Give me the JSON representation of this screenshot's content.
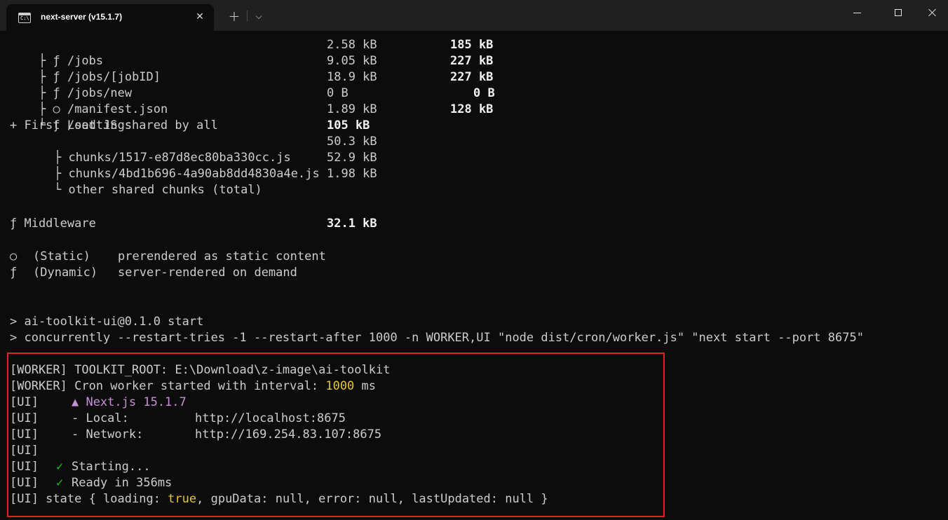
{
  "window": {
    "tab_title": "next-server (v15.1.7)",
    "tab_icon": "terminal-icon",
    "tab_icon_glyph": "C:\\",
    "close_tab_glyph": "✕",
    "new_tab_glyph": "+",
    "dropdown_glyph": "⌵"
  },
  "routes": [
    {
      "tree": "├",
      "type": "ƒ",
      "path": "/jobs",
      "size": "2.58 kB",
      "first_load": "185 kB"
    },
    {
      "tree": "├",
      "type": "ƒ",
      "path": "/jobs/[jobID]",
      "size": "9.05 kB",
      "first_load": "227 kB"
    },
    {
      "tree": "├",
      "type": "ƒ",
      "path": "/jobs/new",
      "size": "18.9 kB",
      "first_load": "227 kB"
    },
    {
      "tree": "├",
      "type": "○",
      "path": "/manifest.json",
      "size": "0 B",
      "first_load": "0 B"
    },
    {
      "tree": "└",
      "type": "ƒ",
      "path": "/settings",
      "size": "1.89 kB",
      "first_load": "128 kB"
    }
  ],
  "shared": {
    "label": "+ First Load JS shared by all",
    "total": "105 kB",
    "chunks": [
      {
        "tree": "├",
        "name": "chunks/1517-e87d8ec80ba330cc.js",
        "size": "50.3 kB"
      },
      {
        "tree": "├",
        "name": "chunks/4bd1b696-4a90ab8dd4830a4e.js",
        "size": "52.9 kB"
      },
      {
        "tree": "└",
        "name": "other shared chunks (total)",
        "size": "1.98 kB"
      }
    ]
  },
  "middleware": {
    "label": "ƒ Middleware",
    "size": "32.1 kB"
  },
  "legend": [
    {
      "symbol": "○",
      "name": "(Static)",
      "desc": "prerendered as static content"
    },
    {
      "symbol": "ƒ",
      "name": "(Dynamic)",
      "desc": "server-rendered on demand"
    }
  ],
  "commands": [
    "> ai-toolkit-ui@0.1.0 start",
    "> concurrently --restart-tries -1 --restart-after 1000 -n WORKER,UI \"node dist/cron/worker.js\" \"next start --port 8675\""
  ],
  "logs": {
    "worker_root": "[WORKER] TOOLKIT_ROOT: E:\\Download\\z-image\\ai-toolkit",
    "worker_cron_prefix": "[WORKER] Cron worker started with interval: ",
    "worker_cron_interval": "1000",
    "worker_cron_suffix": " ms",
    "ui_prefix": "[UI]",
    "next_label": "▲ Next.js 15.1.7",
    "local_label": "- Local:",
    "local_url": "http://localhost:8675",
    "network_label": "- Network:",
    "network_url": "http://169.254.83.107:8675",
    "check": "✓",
    "starting": "Starting...",
    "ready": "Ready in 356ms",
    "state_a": "[UI] state { loading: ",
    "state_loading": "true",
    "state_b": ", gpuData: null, error: null, lastUpdated: null }"
  }
}
